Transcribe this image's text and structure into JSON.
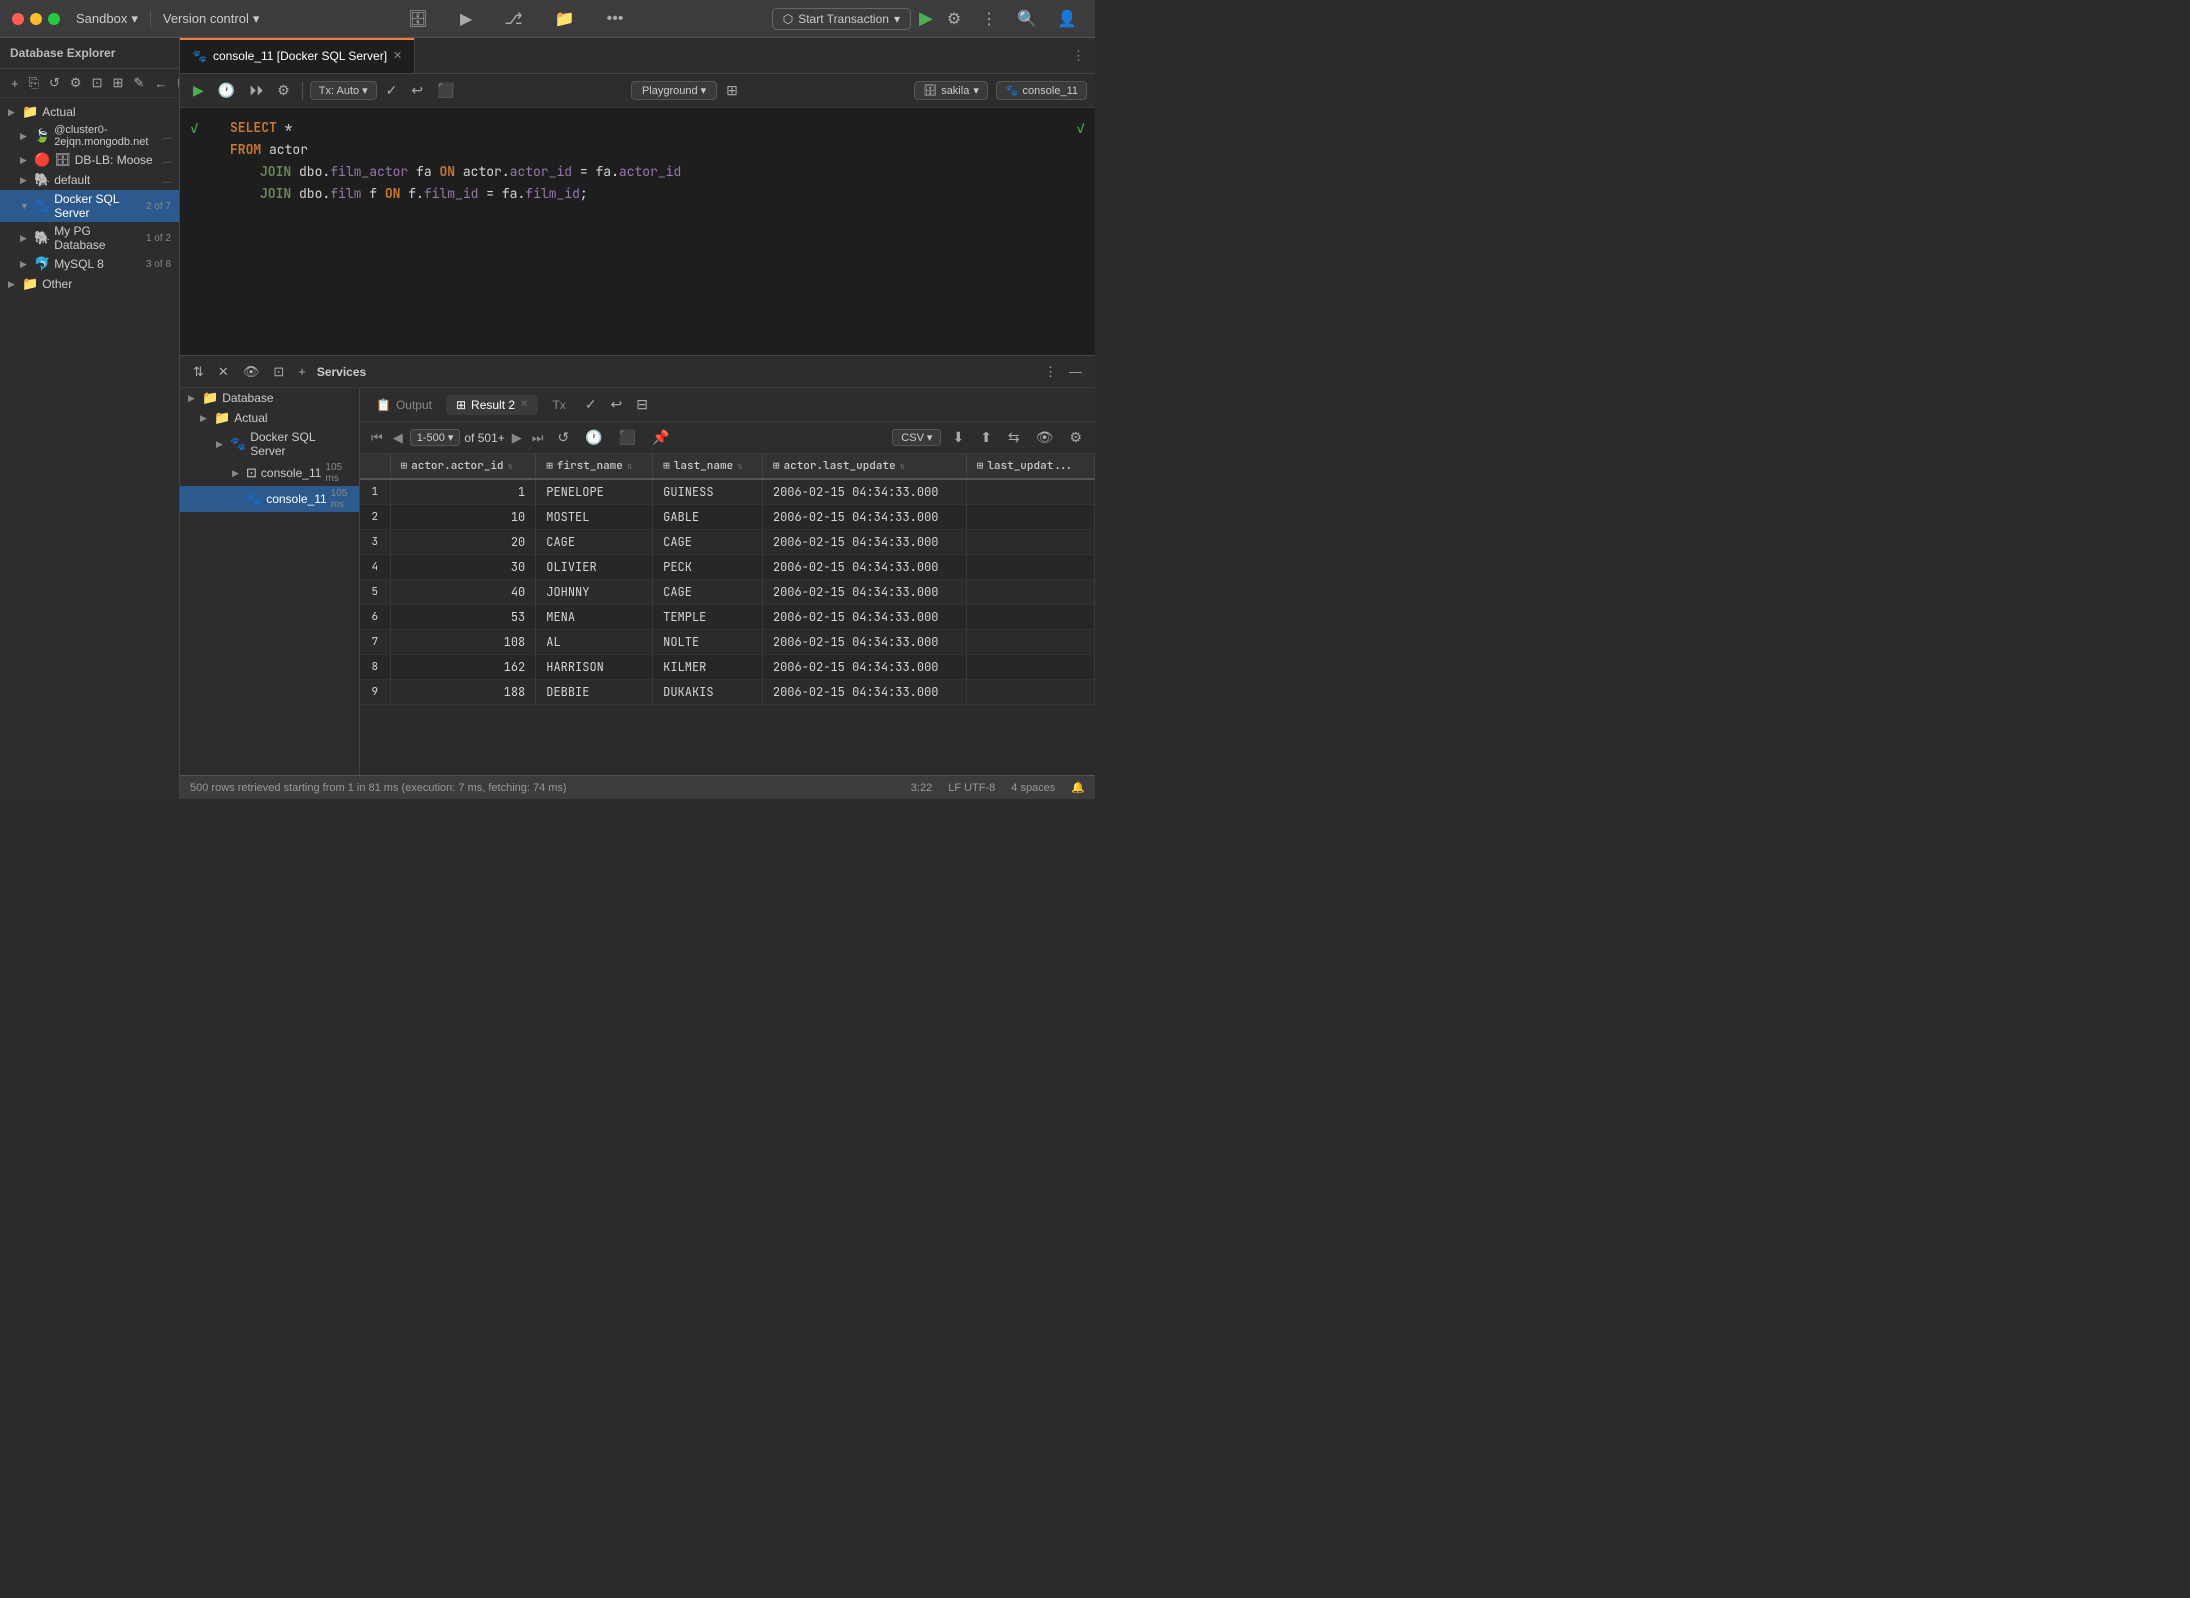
{
  "titlebar": {
    "app_name": "Sandbox",
    "version_control": "Version control",
    "start_transaction": "Start Transaction",
    "chevron": "▾"
  },
  "tab": {
    "label": "console_11 [Docker SQL Server]",
    "icon": "🐾"
  },
  "editor_toolbar": {
    "tx_auto": "Tx: Auto",
    "playground": "Playground",
    "db_schema": "sakila",
    "db_console": "console_11",
    "checkmark": "✓",
    "undo": "↩"
  },
  "editor": {
    "line1": "SELECT *",
    "line2_kw": "FROM",
    "line2_id": "actor",
    "line3_kw": "JOIN",
    "line3_rest": "dbo.film_actor fa",
    "line3_on": "ON",
    "line3_cond": "actor.actor_id = fa.actor_id",
    "line4_kw": "JOIN",
    "line4_rest": "dbo.film f",
    "line4_on": "ON",
    "line4_cond": "f.film_id = fa.film_id;"
  },
  "services": {
    "title": "Services",
    "tree": {
      "database": "Database",
      "actual": "Actual",
      "docker_sql": "Docker SQL Server",
      "console_11_a": "console_11",
      "console_11_a_ms": "105 ms",
      "console_11_b": "console_11",
      "console_11_b_ms": "105 ms"
    }
  },
  "sidebar": {
    "title": "Database Explorer",
    "items": [
      {
        "label": "Actual",
        "type": "folder",
        "indent": 0
      },
      {
        "label": "@cluster0-2ejqn.mongodb.net",
        "type": "mongo",
        "indent": 1,
        "extra": "..."
      },
      {
        "label": "DB-LB: Moose",
        "type": "redis",
        "indent": 1,
        "extra": "..."
      },
      {
        "label": "default",
        "type": "pg",
        "indent": 1,
        "extra": "..."
      },
      {
        "label": "Docker SQL Server",
        "type": "docker",
        "indent": 1,
        "badge": "2 of 7",
        "selected": true
      },
      {
        "label": "My PG Database",
        "type": "pg",
        "indent": 1,
        "badge": "1 of 2"
      },
      {
        "label": "MySQL 8",
        "type": "mysql",
        "indent": 1,
        "badge": "3 of 8"
      },
      {
        "label": "Other",
        "type": "folder",
        "indent": 0
      }
    ]
  },
  "results": {
    "tabs": [
      {
        "label": "Output",
        "active": false,
        "icon": "📋"
      },
      {
        "label": "Result 2",
        "active": true,
        "icon": "⊞",
        "closeable": true
      },
      {
        "label": "Tx",
        "active": false,
        "closeable": false
      }
    ],
    "pagination": {
      "range": "1-500",
      "of": "of 501+",
      "chevron": "▾"
    },
    "csv": "CSV",
    "columns": [
      "",
      "actor.actor_id",
      "first_name",
      "last_name",
      "actor.last_update",
      "last_updat..."
    ],
    "rows": [
      {
        "num": 1,
        "actor_id": 1,
        "first_name": "PENELOPE",
        "last_name": "GUINESS",
        "last_update": "2006-02-15 04:34:33.000"
      },
      {
        "num": 2,
        "actor_id": 10,
        "first_name": "MOSTEL",
        "last_name": "GABLE",
        "last_update": "2006-02-15 04:34:33.000"
      },
      {
        "num": 3,
        "actor_id": 20,
        "first_name": "CAGE",
        "last_name": "CAGE",
        "last_update": "2006-02-15 04:34:33.000"
      },
      {
        "num": 4,
        "actor_id": 30,
        "first_name": "OLIVIER",
        "last_name": "PECK",
        "last_update": "2006-02-15 04:34:33.000"
      },
      {
        "num": 5,
        "actor_id": 40,
        "first_name": "JOHNNY",
        "last_name": "CAGE",
        "last_update": "2006-02-15 04:34:33.000"
      },
      {
        "num": 6,
        "actor_id": 53,
        "first_name": "MENA",
        "last_name": "TEMPLE",
        "last_update": "2006-02-15 04:34:33.000"
      },
      {
        "num": 7,
        "actor_id": 108,
        "first_name": "AL",
        "last_name": "NOLTE",
        "last_update": "2006-02-15 04:34:33.000"
      },
      {
        "num": 8,
        "actor_id": 162,
        "first_name": "HARRISON",
        "last_name": "KILMER",
        "last_update": "2006-02-15 04:34:33.000"
      },
      {
        "num": 9,
        "actor_id": 188,
        "first_name": "DEBBIE",
        "last_name": "DUKAKIS",
        "last_update": "2006-02-15 04:34:33.000"
      }
    ]
  },
  "statusbar": {
    "message": "500 rows retrieved starting from 1 in 81 ms (execution: 7 ms, fetching: 74 ms)",
    "time": "3:22",
    "encoding": "LF  UTF-8",
    "indent": "4 spaces"
  }
}
